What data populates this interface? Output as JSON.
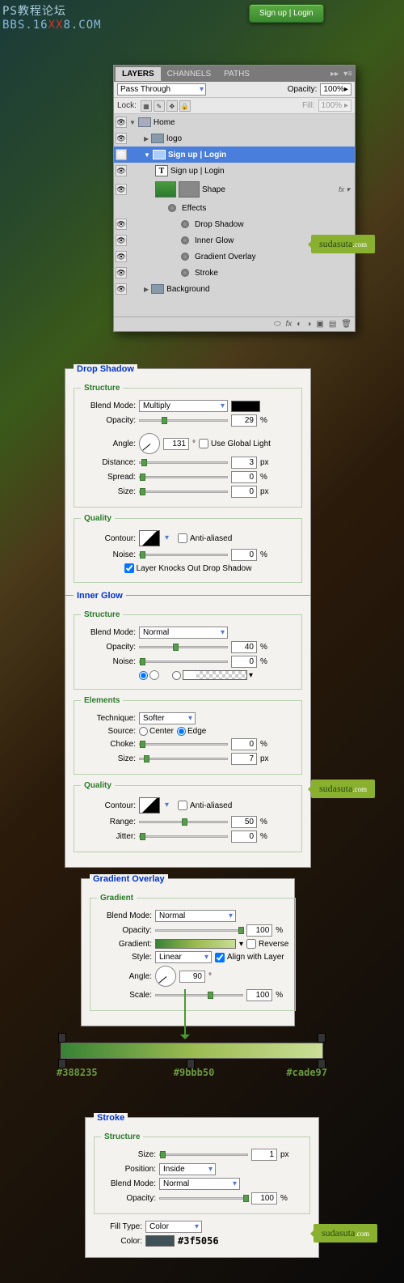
{
  "watermark": {
    "l1": "PS教程论坛",
    "l2a": "BBS.16",
    "l2b": "XX",
    "l2c": "8.COM"
  },
  "demoButton": "Sign up   |   Login",
  "layersPanel": {
    "tabs": [
      "LAYERS",
      "CHANNELS",
      "PATHS"
    ],
    "mode": "Pass Through",
    "opacityLabel": "Opacity:",
    "opacityValue": "100%",
    "lockLabel": "Lock:",
    "fillLabel": "Fill:",
    "fillValue": "100%",
    "layers": {
      "home": "Home",
      "logo": "logo",
      "signupGroup": "Sign up   |   Login",
      "signupText": "Sign up   |   Login",
      "shape": "Shape",
      "effects": "Effects",
      "fx": [
        "Drop Shadow",
        "Inner Glow",
        "Gradient Overlay",
        "Stroke"
      ],
      "background": "Background"
    }
  },
  "dropShadow": {
    "title": "Drop Shadow",
    "structure": "Structure",
    "blendModeLabel": "Blend Mode:",
    "blendMode": "Multiply",
    "opacityLabel": "Opacity:",
    "opacity": "29",
    "angleLabel": "Angle:",
    "angle": "131",
    "globalLight": "Use Global Light",
    "distanceLabel": "Distance:",
    "distance": "3",
    "spreadLabel": "Spread:",
    "spread": "0",
    "sizeLabel": "Size:",
    "size": "0",
    "quality": "Quality",
    "contourLabel": "Contour:",
    "antiAliased": "Anti-aliased",
    "noiseLabel": "Noise:",
    "noise": "0",
    "knockout": "Layer Knocks Out Drop Shadow"
  },
  "innerGlow": {
    "title": "Inner Glow",
    "structure": "Structure",
    "blendModeLabel": "Blend Mode:",
    "blendMode": "Normal",
    "opacityLabel": "Opacity:",
    "opacity": "40",
    "noiseLabel": "Noise:",
    "noise": "0",
    "elements": "Elements",
    "techniqueLabel": "Technique:",
    "technique": "Softer",
    "sourceLabel": "Source:",
    "sourceCenter": "Center",
    "sourceEdge": "Edge",
    "chokeLabel": "Choke:",
    "choke": "0",
    "sizeLabel": "Size:",
    "size": "7",
    "quality": "Quality",
    "contourLabel": "Contour:",
    "antiAliased": "Anti-aliased",
    "rangeLabel": "Range:",
    "range": "50",
    "jitterLabel": "Jitter:",
    "jitter": "0"
  },
  "gradOverlay": {
    "title": "Gradient Overlay",
    "section": "Gradient",
    "blendModeLabel": "Blend Mode:",
    "blendMode": "Normal",
    "opacityLabel": "Opacity:",
    "opacity": "100",
    "gradientLabel": "Gradient:",
    "reverse": "Reverse",
    "styleLabel": "Style:",
    "style": "Linear",
    "alignLayer": "Align with Layer",
    "angleLabel": "Angle:",
    "angle": "90",
    "scaleLabel": "Scale:",
    "scale": "100"
  },
  "gradStops": {
    "c1": "#388235",
    "c2": "#9bbb50",
    "c3": "#cade97"
  },
  "stroke": {
    "title": "Stroke",
    "structure": "Structure",
    "sizeLabel": "Size:",
    "size": "1",
    "positionLabel": "Position:",
    "position": "Inside",
    "blendModeLabel": "Blend Mode:",
    "blendMode": "Normal",
    "opacityLabel": "Opacity:",
    "opacity": "100",
    "fillTypeLabel": "Fill Type:",
    "fillType": "Color",
    "colorLabel": "Color:",
    "colorHex": "#3f5056"
  },
  "badge": {
    "name": "sudasuta",
    "suffix": ".com"
  },
  "units": {
    "pct": "%",
    "px": "px",
    "deg": "°"
  }
}
